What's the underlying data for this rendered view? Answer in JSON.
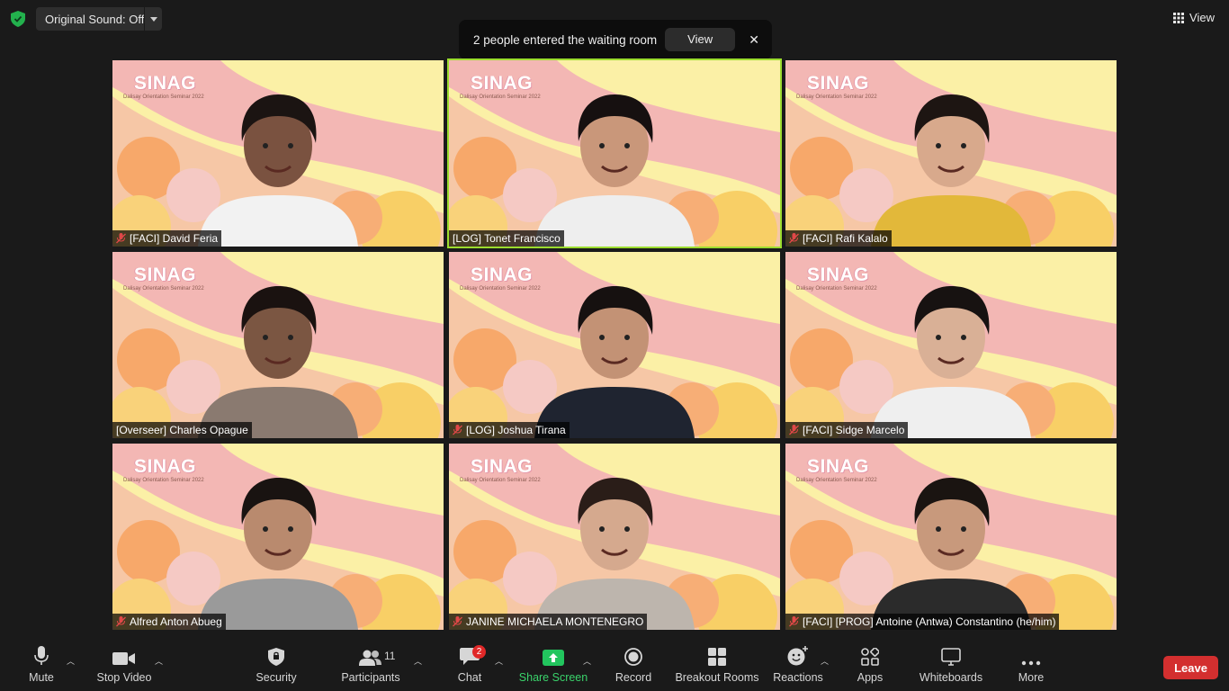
{
  "topbar": {
    "original_sound_label": "Original Sound: Off",
    "view_label": "View"
  },
  "notification": {
    "text": "2 people entered the waiting room",
    "view_button": "View",
    "close_glyph": "✕"
  },
  "tiles": [
    {
      "name": "[FACI] David Feria",
      "muted": true,
      "active": false,
      "brand": "SINAG",
      "brand_sub": "Dalisay Orientation Seminar 2022"
    },
    {
      "name": "[LOG] Tonet Francisco",
      "muted": false,
      "active": true,
      "brand": "SINAG",
      "brand_sub": "Dalisay Orientation Seminar 2022"
    },
    {
      "name": "[FACI] Rafi Kalalo",
      "muted": true,
      "active": false,
      "brand": "SINAG",
      "brand_sub": "Dalisay Orientation Seminar 2022"
    },
    {
      "name": "[Overseer] Charles Opague",
      "muted": false,
      "active": false,
      "brand": "SINAG",
      "brand_sub": "Dalisay Orientation Seminar 2022"
    },
    {
      "name": "[LOG] Joshua Tirana",
      "muted": true,
      "active": false,
      "brand": "SINAG",
      "brand_sub": "Dalisay Orientation Seminar 2022"
    },
    {
      "name": "[FACI] Sidge Marcelo",
      "muted": true,
      "active": false,
      "brand": "SINAG",
      "brand_sub": "Dalisay Orientation Seminar 2022"
    },
    {
      "name": "Alfred Anton Abueg",
      "muted": true,
      "active": false,
      "brand": "SINAG",
      "brand_sub": "Dalisay Orientation Seminar 2022"
    },
    {
      "name": "JANINE MICHAELA MONTENEGRO",
      "muted": true,
      "active": false,
      "brand": "SINAG",
      "brand_sub": "Dalisay Orientation Seminar 2022"
    },
    {
      "name": "[FACI] [PROG] Antoine (Antwa) Constantino (he/him)",
      "muted": true,
      "active": false,
      "brand": "SINAG",
      "brand_sub": "Dalisay Orientation Seminar 2022"
    }
  ],
  "toolbar": {
    "mute": "Mute",
    "stop_video": "Stop Video",
    "security": "Security",
    "participants": "Participants",
    "participants_count": "11",
    "chat": "Chat",
    "chat_badge": "2",
    "share_screen": "Share Screen",
    "record": "Record",
    "breakout_rooms": "Breakout Rooms",
    "reactions": "Reactions",
    "apps": "Apps",
    "whiteboards": "Whiteboards",
    "more": "More",
    "leave": "Leave"
  },
  "colors": {
    "background": "#1a1a1a",
    "active_speaker": "#9bdc2e",
    "share_green": "#22c55e",
    "leave_red": "#d32f2f",
    "badge_red": "#e02828"
  }
}
